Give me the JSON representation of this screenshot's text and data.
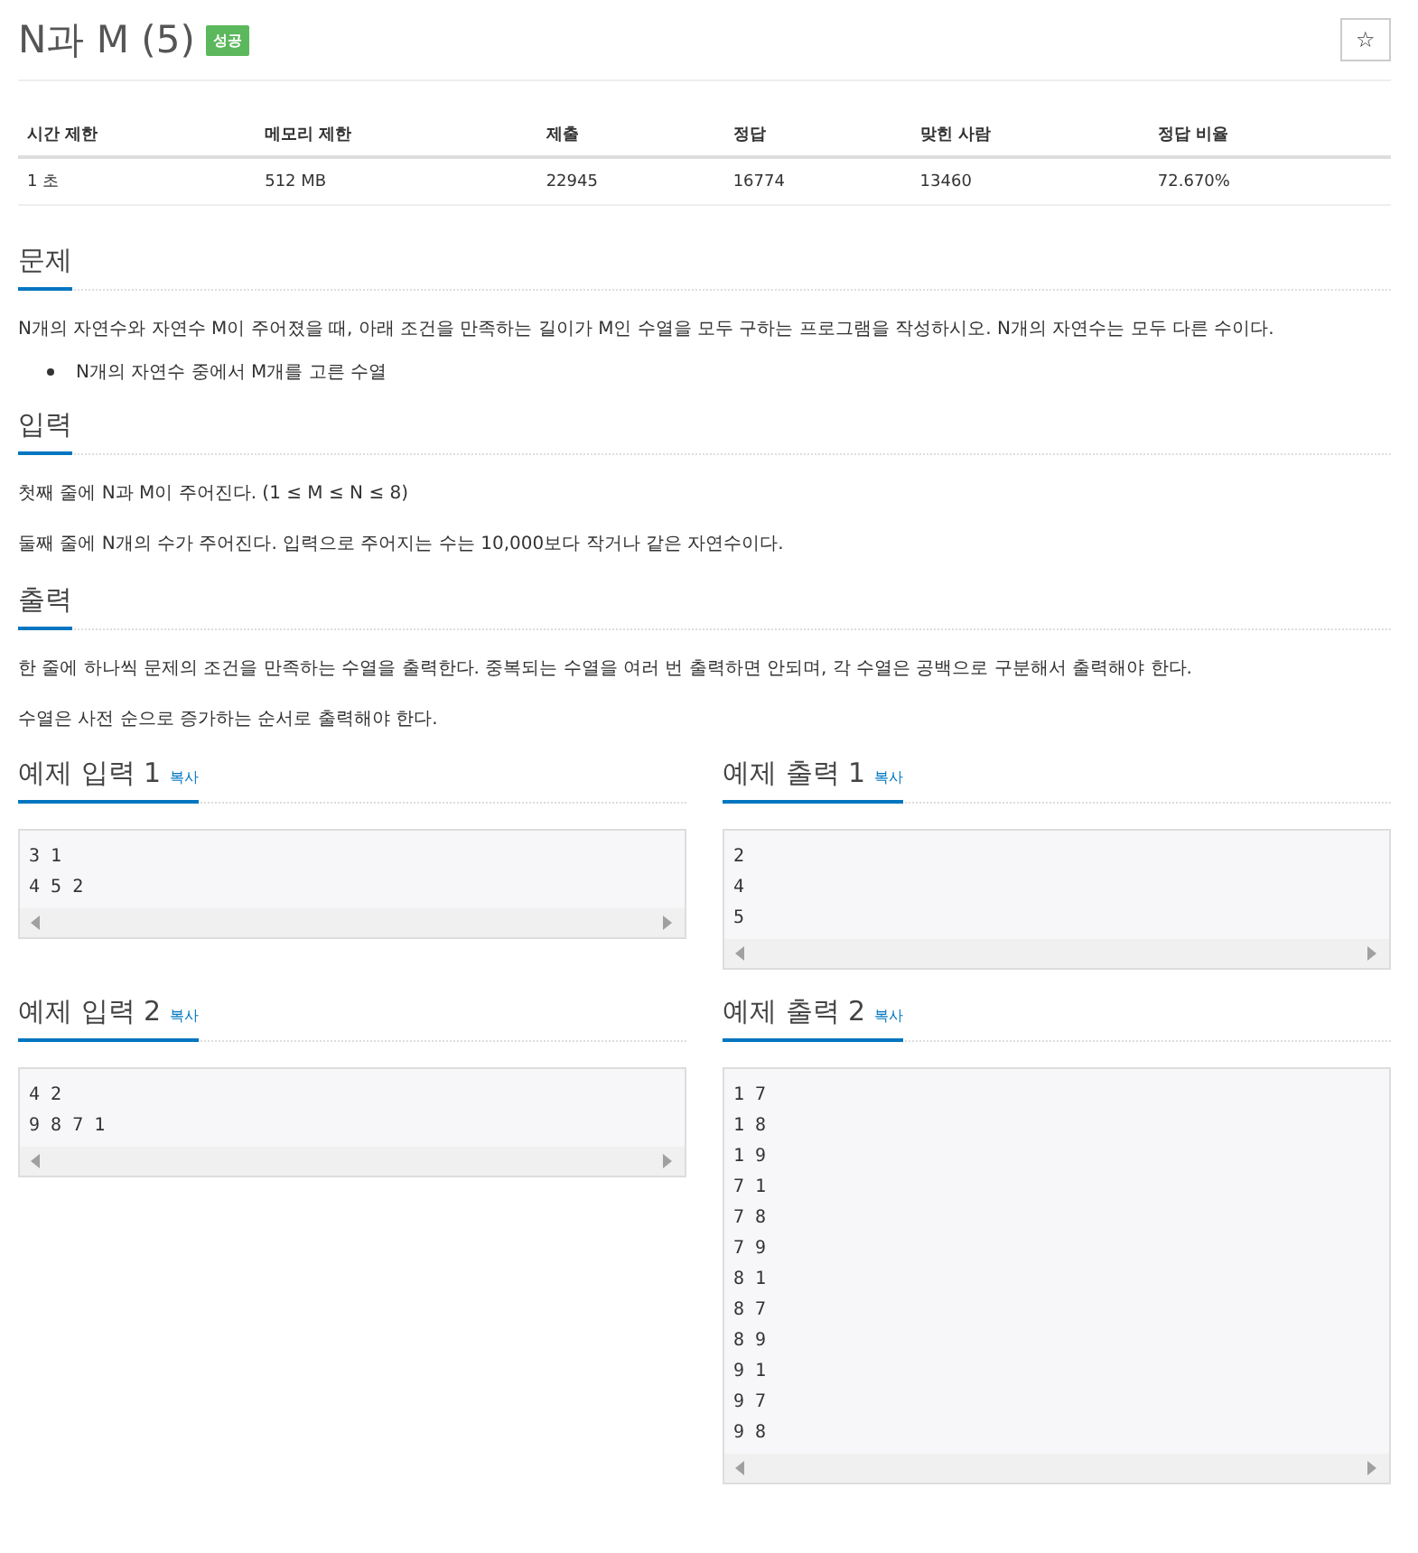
{
  "title": "N과 M (5)",
  "result_badge": "성공",
  "star_button": "☆",
  "info_table": {
    "columns": [
      "시간 제한",
      "메모리 제한",
      "제출",
      "정답",
      "맞힌 사람",
      "정답 비율"
    ],
    "rows": [
      [
        "1 초",
        "512 MB",
        "22945",
        "16774",
        "13460",
        "72.670%"
      ]
    ]
  },
  "sections": [
    {
      "heading": "문제",
      "paragraphs": [
        "N개의 자연수와 자연수 M이 주어졌을 때, 아래 조건을 만족하는 길이가 M인 수열을 모두 구하는 프로그램을 작성하시오. N개의 자연수는 모두 다른 수이다."
      ],
      "bullets": [
        "N개의 자연수 중에서 M개를 고른 수열"
      ]
    },
    {
      "heading": "입력",
      "paragraphs": [
        "첫째 줄에 N과 M이 주어진다. (1 ≤ M ≤ N ≤ 8)",
        "둘째 줄에 N개의 수가 주어진다. 입력으로 주어지는 수는 10,000보다 작거나 같은 자연수이다."
      ]
    },
    {
      "heading": "출력",
      "paragraphs": [
        "한 줄에 하나씩 문제의 조건을 만족하는 수열을 출력한다. 중복되는 수열을 여러 번 출력하면 안되며, 각 수열은 공백으로 구분해서 출력해야 한다.",
        "수열은 사전 순으로 증가하는 순서로 출력해야 한다."
      ]
    }
  ],
  "samples": [
    {
      "heading": "예제 입력 1",
      "copy": "복사",
      "lines": [
        "3 1",
        "4 5 2"
      ]
    },
    {
      "heading": "예제 출력 1",
      "copy": "복사",
      "lines": [
        "2",
        "4",
        "5"
      ]
    },
    {
      "heading": "예제 입력 2",
      "copy": "복사",
      "lines": [
        "4 2",
        "9 8 7 1"
      ]
    },
    {
      "heading": "예제 출력 2",
      "copy": "복사",
      "lines": [
        "1 7",
        "1 8",
        "1 9",
        "7 1",
        "7 8",
        "7 9",
        "8 1",
        "8 7",
        "8 9",
        "9 1",
        "9 7",
        "9 8"
      ]
    }
  ]
}
